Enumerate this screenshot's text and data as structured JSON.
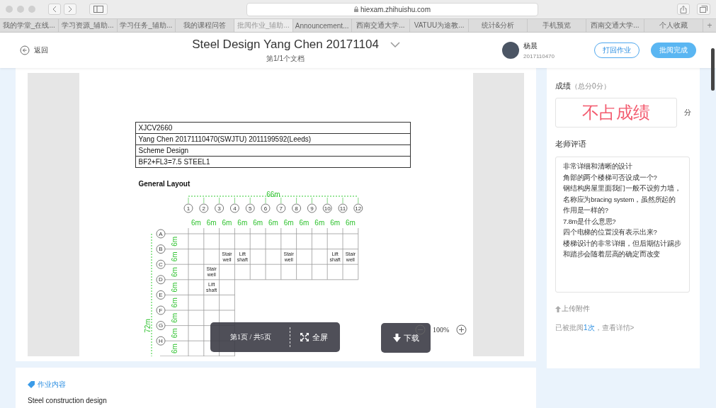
{
  "browser": {
    "url": "hiexam.zhihuishu.com",
    "new_tab": "+",
    "tabs": [
      {
        "label": "我的学堂_在线...",
        "selected": false
      },
      {
        "label": "学习资源_辅助...",
        "selected": false
      },
      {
        "label": "学习任务_辅助...",
        "selected": false
      },
      {
        "label": "我的课程问答",
        "selected": false
      },
      {
        "label": "批阅作业_辅助...",
        "selected": true
      },
      {
        "label": "Announcement...",
        "selected": false
      },
      {
        "label": "西南交通大学...",
        "selected": false
      },
      {
        "label": "VATUU为途教...",
        "selected": false
      },
      {
        "label": "统计&分析",
        "selected": false
      },
      {
        "label": "手机预览",
        "selected": false
      },
      {
        "label": "西南交通大学...",
        "selected": false
      },
      {
        "label": "个人收藏",
        "selected": false
      }
    ]
  },
  "header": {
    "back_label": "返回",
    "title": "Steel Design Yang Chen 20171104",
    "subtitle": "第1/1个文档",
    "user": {
      "name": "杨晨",
      "id": "2017110470"
    },
    "buttons": [
      {
        "label": "打回作业",
        "kind": "outline"
      },
      {
        "label": "批阅完成",
        "kind": "primary"
      }
    ]
  },
  "document": {
    "table_rows": [
      "XJCV2660",
      "Yang Chen 20171110470(SWJTU) 2011199592(Leeds)",
      "Scheme Design",
      "BF2+FL3=7.5 STEEL1"
    ],
    "heading": "General Layout",
    "plan": {
      "overall_width": "66m",
      "overall_height": "72m",
      "columns": [
        "1",
        "2",
        "3",
        "4",
        "5",
        "6",
        "7",
        "8",
        "9",
        "10",
        "11",
        "12"
      ],
      "column_spans": [
        "6m",
        "6m",
        "6m",
        "6m",
        "6m",
        "6m",
        "6m",
        "6m",
        "6m",
        "6m",
        "6m"
      ],
      "rows": [
        "A",
        "B",
        "C",
        "D",
        "E",
        "F",
        "G",
        "H"
      ],
      "row_spans": [
        "6m",
        "6m",
        "6m",
        "6m",
        "6m",
        "6m",
        "6m",
        "6m"
      ],
      "rooms": [
        {
          "label": "Stair well"
        },
        {
          "label": "Lift shaft"
        },
        {
          "label": "Stair well"
        },
        {
          "label": "Lift shaft"
        },
        {
          "label": "Stair well"
        },
        {
          "label": "Stair well"
        },
        {
          "label": "Lift shaft"
        }
      ]
    }
  },
  "viewer": {
    "page_indicator": "第1页 / 共5页",
    "fullscreen_label": "全屏",
    "download_label": "下载",
    "zoom": "100%"
  },
  "grading": {
    "score_label": "成绩",
    "total": "（总分0分）",
    "score_value": "不占成绩",
    "unit": "分",
    "comment_label": "老师评语",
    "comment_lines": [
      "非常详细和清晰的设计",
      "角部的两个楼梯可否设成一个?",
      "钢结构房屋里面我们一般不设剪力墙，名称应为bracing system，虽然所起的作用是一样的?",
      "7.8m是什么意思?",
      "四个电梯的位置没有表示出来?",
      "楼梯设计的非常详细，但后期估计踢步和踏步会随着层高的确定而改变"
    ],
    "upload_label": "上传附件",
    "history_prefix": "已被批阅",
    "history_count": "1次",
    "history_link": "，查看详情>"
  },
  "assignment": {
    "label": "作业内容",
    "text": "Steel construction design"
  }
}
